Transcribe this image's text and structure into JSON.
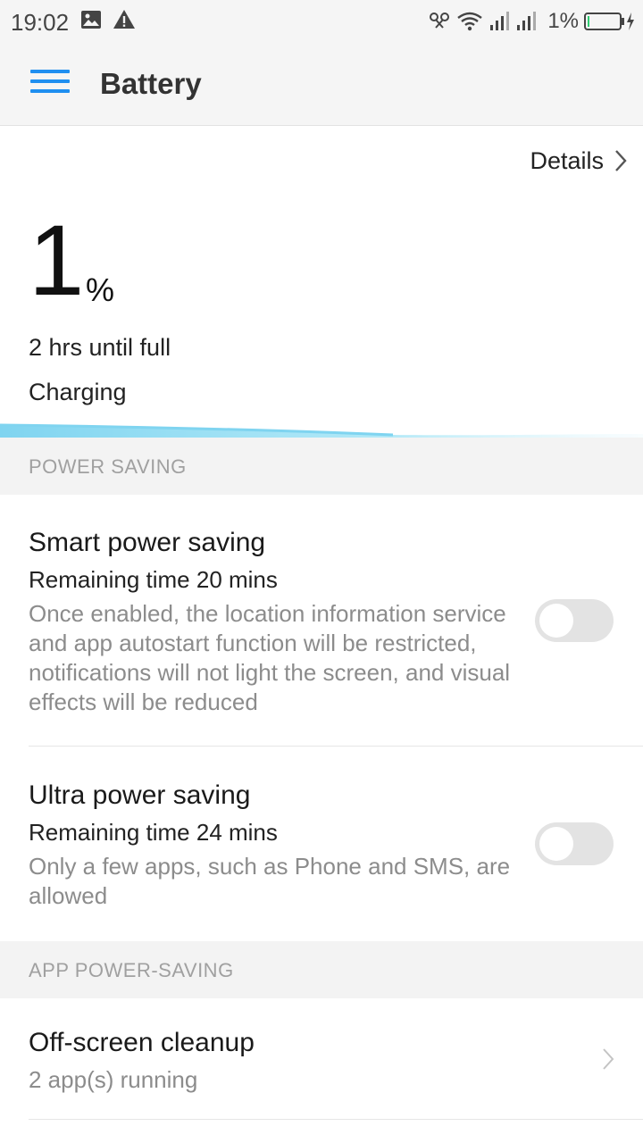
{
  "status_bar": {
    "time": "19:02",
    "battery_percent": "1%",
    "icons": [
      "image-icon",
      "alert-icon",
      "link-icon",
      "wifi-icon",
      "signal-icon",
      "signal-icon",
      "battery-charging-icon"
    ]
  },
  "app_bar": {
    "title": "Battery"
  },
  "summary": {
    "details_label": "Details",
    "percent_value": "1",
    "percent_sign": "%",
    "time_to_full": "2 hrs until full",
    "state": "Charging"
  },
  "sections": {
    "power_saving": "POWER SAVING",
    "app_power_saving": "APP POWER-SAVING"
  },
  "smart_saving": {
    "title": "Smart power saving",
    "remaining": "Remaining time 20 mins",
    "description": "Once enabled, the location information service and app autostart function will be restricted, notifications will not light the screen, and visual effects will be reduced",
    "enabled": false
  },
  "ultra_saving": {
    "title": "Ultra power saving",
    "remaining": "Remaining time 24 mins",
    "description": "Only a few apps, such as Phone and SMS, are allowed",
    "enabled": false
  },
  "offscreen_cleanup": {
    "title": "Off-screen cleanup",
    "subtitle": "2 app(s) running"
  },
  "colors": {
    "accent": "#1f8ff0",
    "wave": "#7fd4f0",
    "toggle_off": "#e3e3e3"
  }
}
